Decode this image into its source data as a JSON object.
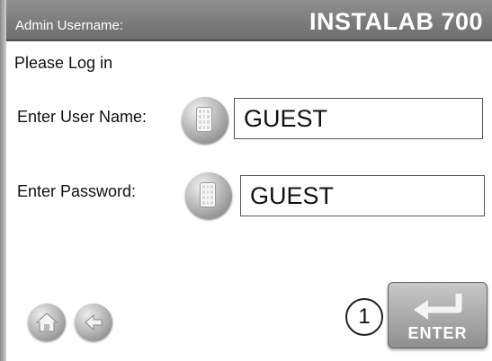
{
  "header": {
    "subtitle": "Admin Username:",
    "product_name": "INSTALAB 700"
  },
  "login": {
    "heading": "Please Log in",
    "username_label": "Enter User Name:",
    "username_value": "GUEST",
    "password_label": "Enter Password:",
    "password_value": "GUEST"
  },
  "footer": {
    "callout_number": "1",
    "enter_label": "ENTER"
  },
  "icons": {
    "keypad": "keypad-icon",
    "home": "home-icon",
    "back": "back-arrow-icon",
    "enter": "enter-return-icon"
  },
  "colors": {
    "titlebar": "#7d7d7d",
    "background": "#ffffff",
    "button_gray": "#a7a7a7"
  }
}
